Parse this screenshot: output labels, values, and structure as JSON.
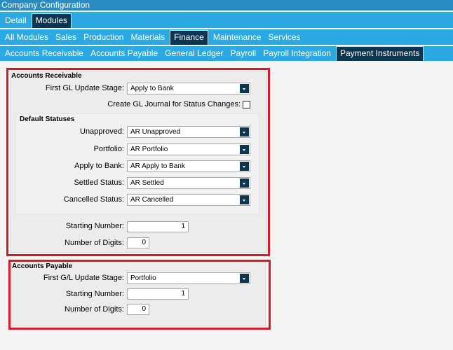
{
  "window": {
    "title": "Company Configuration"
  },
  "tabs1": [
    {
      "label": "Detail"
    },
    {
      "label": "Modules",
      "selected": true
    }
  ],
  "tabs2": [
    {
      "label": "All Modules"
    },
    {
      "label": "Sales"
    },
    {
      "label": "Production"
    },
    {
      "label": "Materials"
    },
    {
      "label": "Finance",
      "selected": true
    },
    {
      "label": "Maintenance"
    },
    {
      "label": "Services"
    }
  ],
  "tabs3": [
    {
      "label": "Accounts Receivable"
    },
    {
      "label": "Accounts Payable"
    },
    {
      "label": "General Ledger"
    },
    {
      "label": "Payroll"
    },
    {
      "label": "Payroll Integration"
    },
    {
      "label": "Payment Instruments",
      "selected": true
    }
  ],
  "ar": {
    "heading": "Accounts Receivable",
    "first_gl_label": "First GL Update Stage:",
    "first_gl_value": "Apply to Bank",
    "create_journal_label": "Create GL Journal for Status Changes:",
    "create_journal_checked": false,
    "default_statuses": {
      "heading": "Default Statuses",
      "rows": [
        {
          "label": "Unapproved:",
          "value": "AR Unapproved"
        },
        {
          "label": "Portfolio:",
          "value": "AR Portfolio"
        },
        {
          "label": "Apply to Bank:",
          "value": "AR Apply to Bank"
        },
        {
          "label": "Settled Status:",
          "value": "AR Settled"
        },
        {
          "label": "Cancelled Status:",
          "value": "AR Cancelled"
        }
      ]
    },
    "starting_number_label": "Starting Number:",
    "starting_number": "1",
    "digits_label": "Number of Digits:",
    "digits": "0"
  },
  "ap": {
    "heading": "Accounts Payable",
    "first_gl_label": "First G/L Update Stage:",
    "first_gl_value": "Portfolio",
    "starting_number_label": "Starting Number:",
    "starting_number": "1",
    "digits_label": "Number of Digits:",
    "digits": "0"
  },
  "colors": {
    "tab_bar": "#2aa9e2",
    "selected_tab": "#0c3552",
    "highlight_box": "#d51a2a"
  }
}
